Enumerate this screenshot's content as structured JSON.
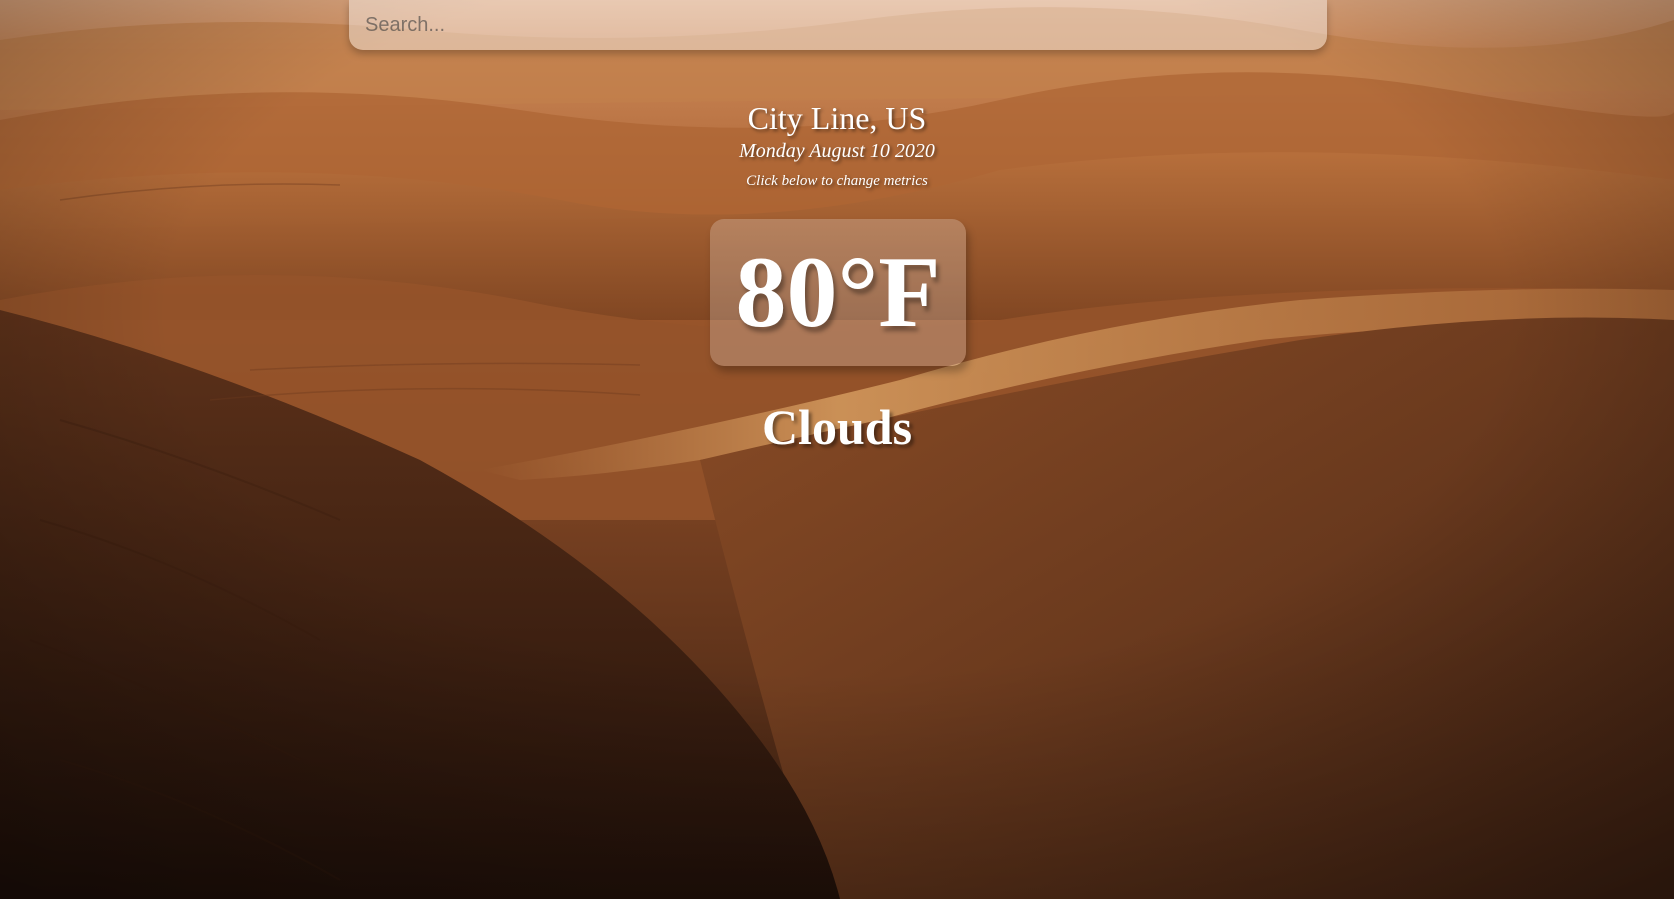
{
  "search": {
    "placeholder": "Search..."
  },
  "location": {
    "city": "City Line, US",
    "date": "Monday August 10 2020",
    "hint": "Click below to change metrics"
  },
  "weather": {
    "temperature": "80°F",
    "condition": "Clouds"
  }
}
